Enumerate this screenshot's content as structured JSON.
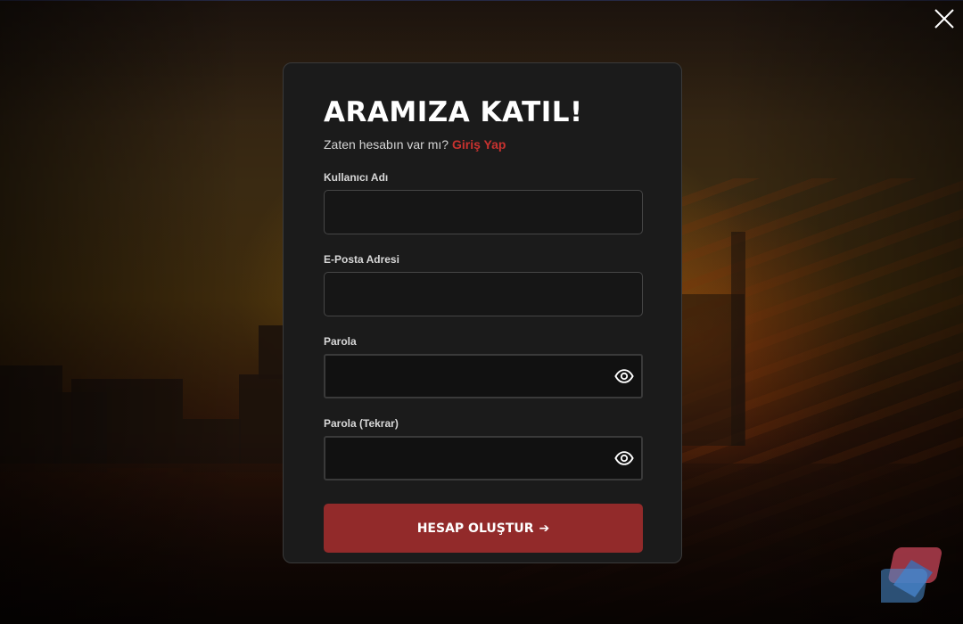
{
  "colors": {
    "accent": "#c8322f",
    "button_bg": "#922a2a",
    "card_bg": "#1b1b1b"
  },
  "form": {
    "title": "ARAMIZA KATIL!",
    "subtitle_text": "Zaten hesabın var mı?",
    "login_link": "Giriş Yap",
    "fields": [
      {
        "label": "Kullanıcı Adı",
        "value": "",
        "type": "text"
      },
      {
        "label": "E-Posta Adresi",
        "value": "",
        "type": "email"
      },
      {
        "label": "Parola",
        "value": "",
        "type": "password"
      },
      {
        "label": "Parola (Tekrar)",
        "value": "",
        "type": "password"
      }
    ],
    "submit_label": "HESAP OLUŞTUR",
    "submit_arrow": "➔"
  },
  "icons": {
    "close": "close-icon",
    "password_toggle": "eye-icon",
    "corner_badge": "app-logo-icon"
  }
}
